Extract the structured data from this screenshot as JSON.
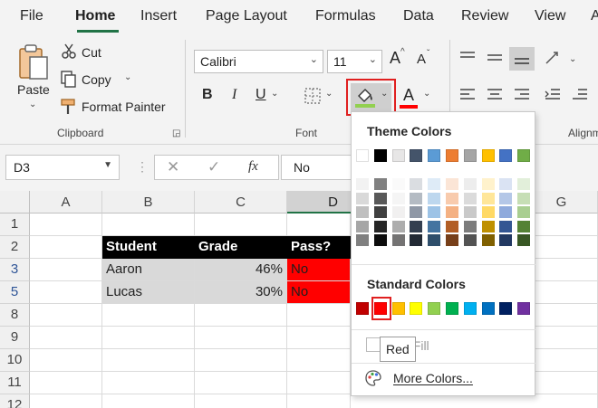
{
  "menu": {
    "tabs": [
      "File",
      "Home",
      "Insert",
      "Page Layout",
      "Formulas",
      "Data",
      "Review",
      "View",
      "A"
    ],
    "active": "Home"
  },
  "ribbon": {
    "clipboard": {
      "paste": "Paste",
      "cut": "Cut",
      "copy": "Copy",
      "format_painter": "Format Painter",
      "label": "Clipboard"
    },
    "font": {
      "family": "Calibri",
      "size": "11",
      "bold": "B",
      "italic": "I",
      "underline": "U",
      "font_color_letter": "A",
      "grow_letter": "A",
      "shrink_letter": "A",
      "label": "Font"
    },
    "alignment": {
      "label": "Alignm"
    }
  },
  "formula_bar": {
    "name_box": "D3",
    "fx": "fx",
    "value": "No"
  },
  "grid": {
    "columns": [
      "A",
      "B",
      "C",
      "D",
      "G"
    ],
    "rows": [
      "1",
      "2",
      "3",
      "5",
      "8",
      "9",
      "10",
      "11",
      "12"
    ],
    "header_row": [
      "Student",
      "Grade",
      "Pass?"
    ],
    "data_rows": [
      [
        "Aaron",
        "46%",
        "No"
      ],
      [
        "Lucas",
        "30%",
        "No"
      ]
    ]
  },
  "color_menu": {
    "theme_heading": "Theme Colors",
    "standard_heading": "Standard Colors",
    "no_fill": "No Fill",
    "more_colors": "More Colors...",
    "tooltip": "Red",
    "theme_colors": [
      "#ffffff",
      "#000000",
      "#e7e6e6",
      "#44546a",
      "#5b9bd5",
      "#ed7d31",
      "#a5a5a5",
      "#ffc000",
      "#4472c4",
      "#70ad47"
    ],
    "standard_colors": [
      "#c00000",
      "#ff0000",
      "#ffc000",
      "#ffff00",
      "#92d050",
      "#00b050",
      "#00b0f0",
      "#0070c0",
      "#002060",
      "#7030a0"
    ],
    "selected_standard": "#ff0000"
  },
  "colors": {
    "accent_green": "#217346",
    "highlight_red": "#e02020",
    "fill_bar": "#92d050",
    "font_color_bar": "#ff0000"
  }
}
